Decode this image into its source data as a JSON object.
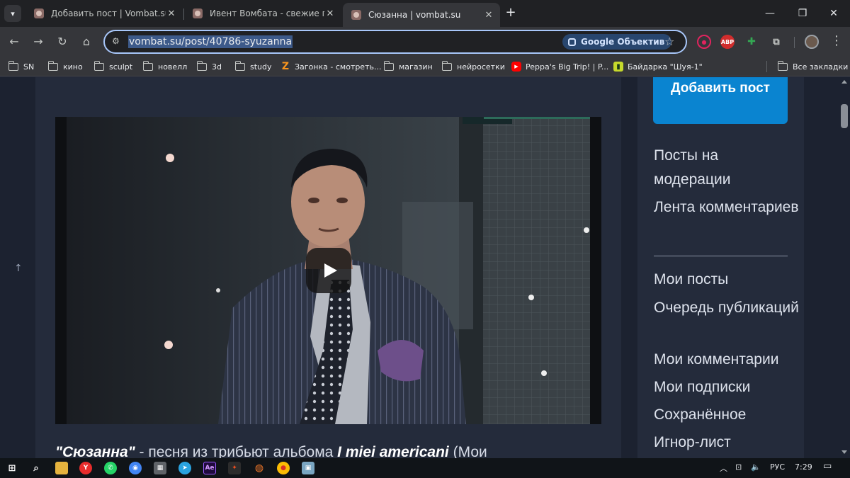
{
  "browser": {
    "tabs": [
      {
        "title": "Добавить пост | Vombat.su",
        "active": false
      },
      {
        "title": "Ивент Вомбата - свежие посты",
        "active": false
      },
      {
        "title": "Сюзанна | vombat.su",
        "active": true
      }
    ],
    "new_tab_symbol": "+",
    "url": "vombat.su/post/40786-syuzanna",
    "lens_label": "Google Объектив",
    "extensions": [
      "record-icon",
      "abp-icon",
      "puzzle-extension-icon",
      "extensions-icon"
    ],
    "abp_label": "ABP"
  },
  "bookmarks": [
    {
      "label": "SN",
      "icon": "folder-icon"
    },
    {
      "label": "кино",
      "icon": "folder-icon"
    },
    {
      "label": "sculpt",
      "icon": "folder-icon"
    },
    {
      "label": "новелл",
      "icon": "folder-icon"
    },
    {
      "label": "3d",
      "icon": "folder-icon"
    },
    {
      "label": "study",
      "icon": "folder-icon"
    },
    {
      "label": "Загонка - смотреть...",
      "icon": "zagonka-icon"
    },
    {
      "label": "магазин",
      "icon": "folder-icon"
    },
    {
      "label": "нейросетки",
      "icon": "folder-icon"
    },
    {
      "label": "Peppa's Big Trip! | P...",
      "icon": "youtube-icon"
    },
    {
      "label": "Байдарка \"Шуя-1\"",
      "icon": "site-icon"
    },
    {
      "label": "Все закладки",
      "icon": "folder-icon"
    }
  ],
  "post": {
    "text_title": "\"Сюзанна\"",
    "text_rest": " - песня из  трибьют альбома ",
    "text_album": "I miei americani",
    "text_tail": " (Мои"
  },
  "sidebar": {
    "add_post": "Добавить пост",
    "links_top": [
      "Посты на модерации",
      "Лента комментариев"
    ],
    "links_bottom": [
      "Мои посты",
      "Очередь публикаций",
      "Мои комментарии",
      "Мои подписки",
      "Сохранённое",
      "Игнор-лист"
    ]
  },
  "taskbar": {
    "lang": "РУС",
    "time": "7:29"
  },
  "colors": {
    "accent": "#0a84d0",
    "page_bg": "#1c2230",
    "card_bg": "#242b3b"
  }
}
